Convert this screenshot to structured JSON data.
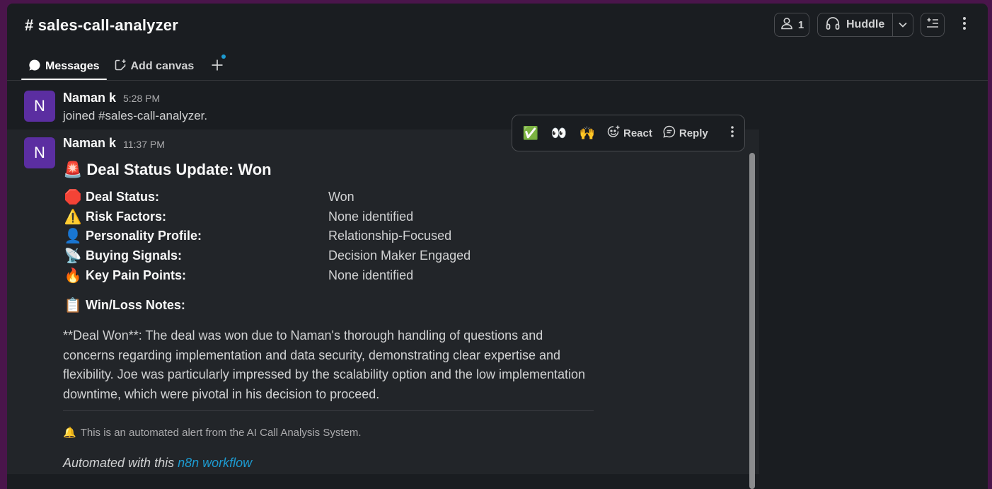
{
  "channel": {
    "title": "# sales-call-analyzer"
  },
  "header_buttons": {
    "members_count": "1",
    "huddle_label": "Huddle"
  },
  "tabs": [
    {
      "label": "Messages"
    },
    {
      "label": "Add canvas"
    }
  ],
  "colors": {
    "accent_link": "#1d9bd1",
    "avatar_bg": "#5b2ea1",
    "background": "#1a1d21"
  },
  "messages": [
    {
      "avatar_letter": "N",
      "sender": "Naman k",
      "time": "5:28 PM",
      "text": "joined #sales-call-analyzer."
    },
    {
      "avatar_letter": "N",
      "sender": "Naman k",
      "time": "11:37 PM",
      "heading_emoji": "🚨",
      "heading": "Deal Status Update: Won",
      "fields": [
        {
          "emoji": "🛑",
          "label": "Deal Status:",
          "value": "Won"
        },
        {
          "emoji": "⚠️",
          "label": "Risk Factors:",
          "value": "None identified"
        },
        {
          "emoji": "👤",
          "label": "Personality Profile:",
          "value": "Relationship-Focused"
        },
        {
          "emoji": "📡",
          "label": "Buying Signals:",
          "value": "Decision Maker Engaged"
        },
        {
          "emoji": "🔥",
          "label": "Key Pain Points:",
          "value": "None identified"
        }
      ],
      "notes_emoji": "📋",
      "notes_title": "Win/Loss Notes:",
      "notes_body": "**Deal Won**: The deal was won due to Naman's thorough handling of questions and concerns regarding implementation and data security, demonstrating clear expertise and flexibility. Joe was particularly impressed by the scalability option and the low implementation downtime, which were pivotal in his decision to proceed.",
      "footer_emoji": "🔔",
      "footer_note": "This is an automated alert from the AI Call Analysis System.",
      "automated_prefix": "Automated with this",
      "automated_link": "n8n workflow"
    }
  ],
  "hover_actions": {
    "quick_reactions": [
      "✅",
      "👀",
      "🙌"
    ],
    "react_label": "React",
    "reply_label": "Reply"
  }
}
